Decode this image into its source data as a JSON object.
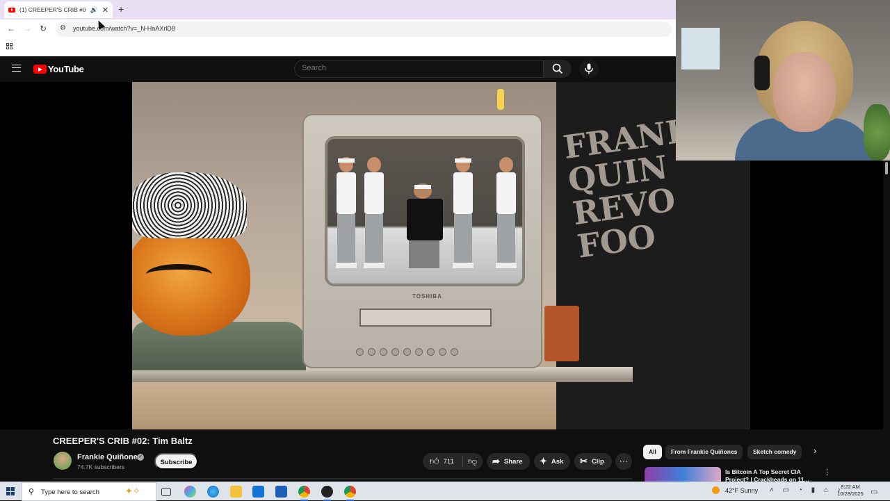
{
  "browser": {
    "tab_title": "(1) CREEPER'S CRIB #02: Tim",
    "tab_audio_icon": "speaker-icon",
    "tab_close": "✕",
    "new_tab": "+",
    "url": "youtube.com/watch?v=_N-HaAXrlD8",
    "back": "←",
    "forward": "→",
    "reload": "↻"
  },
  "youtube": {
    "logo_text": "YouTube",
    "search_placeholder": "Search",
    "colors": {
      "brand_red": "#ff0000",
      "background": "#0f0f0f"
    },
    "video": {
      "title": "CREEPER'S CRIB #02: Tim Baltz",
      "tv_brand": "TOSHIBA",
      "shirt_text": "FRANKIE QUIÑONES"
    },
    "channel": {
      "name": "Frankie Quiñones",
      "subscribers": "74.7K subscribers",
      "verified": "✓",
      "subscribe_label": "Subscribe"
    },
    "actions": {
      "likes": "711",
      "share": "Share",
      "ask": "Ask",
      "clip": "Clip",
      "more": "⋯"
    },
    "chips": [
      "All",
      "From Frankie Quiñones",
      "Sketch comedy"
    ],
    "chip_next": "›",
    "recommendation": {
      "title": "Is Bitcoin A Top Secret CIA Project? | Crackheads on 11...",
      "more": "⋮"
    }
  },
  "taskbar": {
    "search_placeholder": "Type here to search",
    "weather": "42°F  Sunny",
    "time": "8:22 AM",
    "date": "10/28/2025",
    "tray_icons": "˄ ▭ ◔ ▮ ⌂ ♪"
  }
}
